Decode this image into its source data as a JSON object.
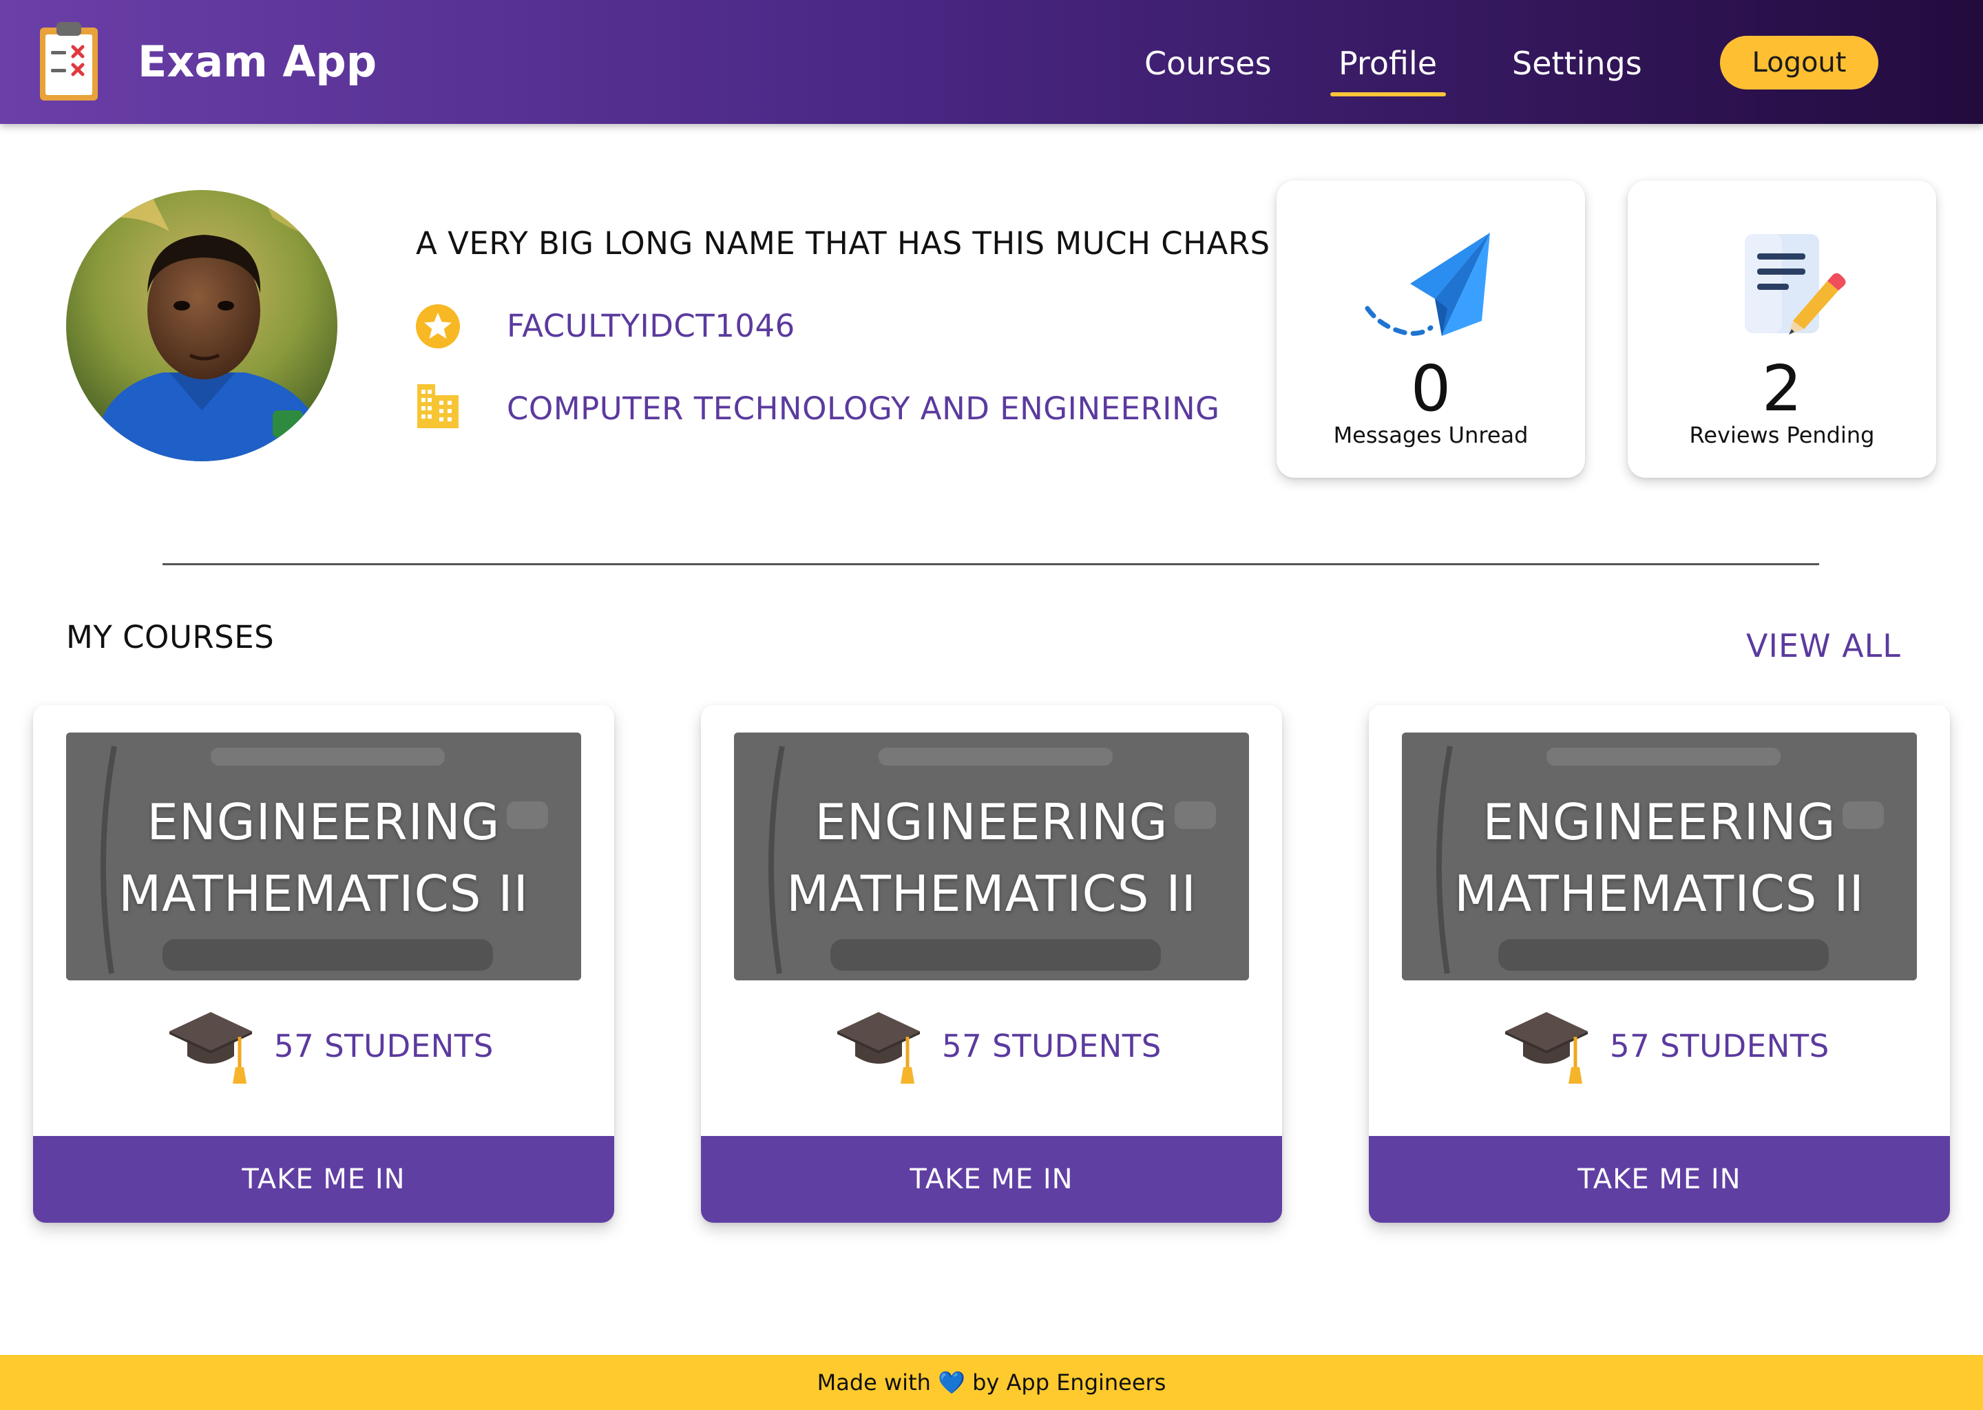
{
  "header": {
    "app_title": "Exam App",
    "nav": [
      {
        "label": "Courses",
        "active": false
      },
      {
        "label": "Profile",
        "active": true
      },
      {
        "label": "Settings",
        "active": false
      }
    ],
    "logout_label": "Logout",
    "logo_icon": "clipboard-checklist-icon",
    "accent_color": "#ffbf33",
    "gradient_colors": [
      "#6a3fa8",
      "#230b3e"
    ]
  },
  "profile": {
    "name": "A VERY BIG LONG NAME THAT HAS THIS MUCH CHARS",
    "faculty_id": "FACULTYIDCT1046",
    "department": "COMPUTER TECHNOLOGY AND ENGINEERING",
    "id_icon": "star-icon",
    "department_icon": "building-icon"
  },
  "stats": [
    {
      "value": "0",
      "label": "Messages Unread",
      "icon": "paper-plane-icon"
    },
    {
      "value": "2",
      "label": "Reviews Pending",
      "icon": "document-pencil-icon"
    }
  ],
  "courses_section": {
    "title": "MY COURSES",
    "view_all_label": "VIEW ALL",
    "courses": [
      {
        "title_line1": "ENGINEERING",
        "title_line2": "MATHEMATICS II",
        "students": "57 STUDENTS",
        "button": "TAKE ME IN"
      },
      {
        "title_line1": "ENGINEERING",
        "title_line2": "MATHEMATICS II",
        "students": "57 STUDENTS",
        "button": "TAKE ME IN"
      },
      {
        "title_line1": "ENGINEERING",
        "title_line2": "MATHEMATICS II",
        "students": "57 STUDENTS",
        "button": "TAKE ME IN"
      }
    ],
    "button_color": "#603fa3",
    "text_accent_color": "#5b3a9e"
  },
  "footer": {
    "text_before": "Made with",
    "heart": "💙",
    "text_after": "by App Engineers",
    "background": "#ffca2e"
  }
}
